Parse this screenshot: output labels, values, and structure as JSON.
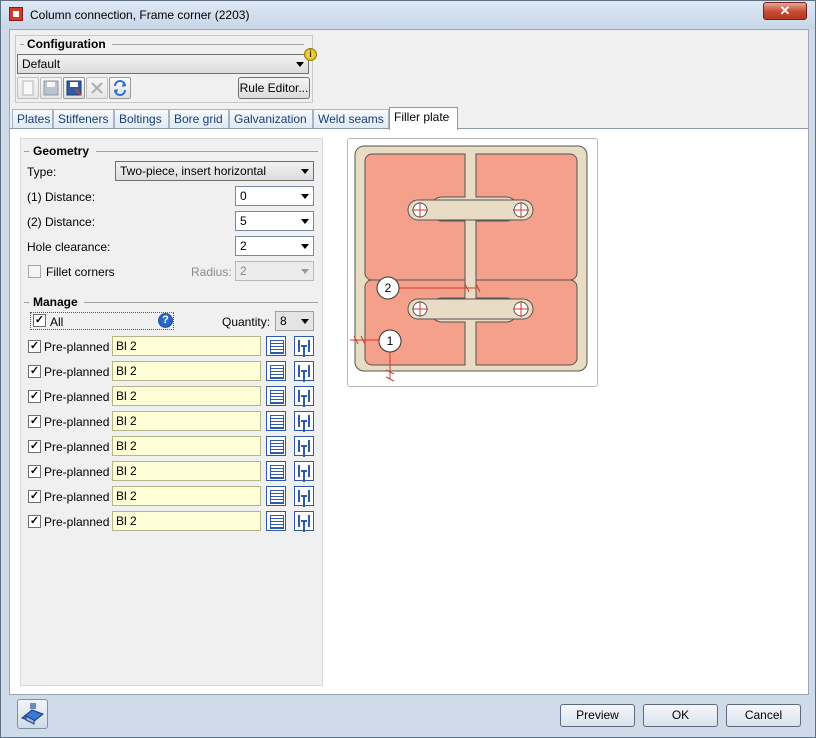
{
  "window": {
    "title": "Column connection, Frame corner (2203)",
    "close_label": "✕"
  },
  "configuration": {
    "group_title": "Configuration",
    "selected": "Default",
    "rule_editor_label": "Rule Editor...",
    "toolbar_icons": [
      "new-icon",
      "save-icon",
      "save-as-icon",
      "delete-icon",
      "refresh-icon"
    ]
  },
  "tabs": [
    {
      "label": "Plates"
    },
    {
      "label": "Stiffeners"
    },
    {
      "label": "Boltings"
    },
    {
      "label": "Bore grid"
    },
    {
      "label": "Galvanization"
    },
    {
      "label": "Weld seams"
    },
    {
      "label": "Filler plate"
    }
  ],
  "active_tab": "Filler plate",
  "geometry": {
    "group_title": "Geometry",
    "type_label": "Type:",
    "type_value": "Two-piece, insert horizontal",
    "distance1_label": "(1) Distance:",
    "distance1_value": "0",
    "distance2_label": "(2) Distance:",
    "distance2_value": "5",
    "hole_clearance_label": "Hole clearance:",
    "hole_clearance_value": "2",
    "fillet_corners_label": "Fillet corners",
    "fillet_corners_checked": false,
    "radius_label": "Radius:",
    "radius_value": "2"
  },
  "manage": {
    "group_title": "Manage",
    "all_label": "All",
    "all_checked": true,
    "quantity_label": "Quantity:",
    "quantity_value": "8",
    "rows": [
      {
        "label": "Pre-planned",
        "value": "Bl 2",
        "checked": true
      },
      {
        "label": "Pre-planned",
        "value": "Bl 2",
        "checked": true
      },
      {
        "label": "Pre-planned",
        "value": "Bl 2",
        "checked": true
      },
      {
        "label": "Pre-planned",
        "value": "Bl 2",
        "checked": true
      },
      {
        "label": "Pre-planned",
        "value": "Bl 2",
        "checked": true
      },
      {
        "label": "Pre-planned",
        "value": "Bl 2",
        "checked": true
      },
      {
        "label": "Pre-planned",
        "value": "Bl 2",
        "checked": true
      },
      {
        "label": "Pre-planned",
        "value": "Bl 2",
        "checked": true
      }
    ]
  },
  "preview": {
    "marker_1": "1",
    "marker_2": "2",
    "plate_color": "#f4a08a",
    "frame_color": "#e8dcc4"
  },
  "footer": {
    "preview_label": "Preview",
    "ok_label": "OK",
    "cancel_label": "Cancel"
  }
}
